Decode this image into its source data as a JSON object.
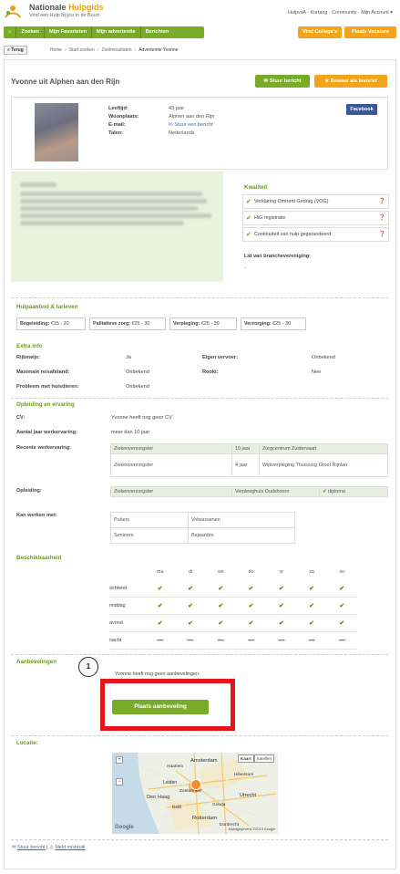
{
  "header": {
    "brand_a": "Nationale ",
    "brand_b": "Hulpgids",
    "slogan": "Vind een Hulp bij jou in de Buurt",
    "top_links": "HulpvsA · Kortang · Community · Mijn Account ▾"
  },
  "nav": {
    "items": [
      "Zoeken",
      "Mijn Favorieten",
      "Mijn advertentie",
      "Berichten"
    ],
    "right": [
      "Vind Collega's",
      "Plaats Vacature"
    ]
  },
  "breadcrumb": {
    "back": "« Terug",
    "items": [
      "Home",
      "Start zoeken",
      "Zoekresultaten",
      "Advertentie Yvonne"
    ]
  },
  "profile": {
    "title": "Yvonne uit Alphen aan den Rijn",
    "send_btn": "Stuur bericht",
    "fav_btn": "Bewaar als favoriet",
    "facebook": "Facebook",
    "fields": [
      {
        "label": "Leeftijd:",
        "value": "43 jaar"
      },
      {
        "label": "Woonplaats:",
        "value": "Alphen aan den Rijn"
      },
      {
        "label": "E-mail:",
        "value": "Stuur een bericht"
      },
      {
        "label": "Talen:",
        "value": "Nederlands"
      }
    ]
  },
  "kwaliteit": {
    "title": "Kwaliteit",
    "items": [
      "Verklaring Omtrent Gedrag (VOG)",
      "HiG registratie",
      "Continuïteit van hulp gegarandeerd"
    ],
    "lid_label": "Lid van branchevereniging:",
    "lid_value": "-"
  },
  "tarieven": {
    "title": "Hulpaanbod & tarieven",
    "items": [
      {
        "label": "Begeleiding:",
        "value": "€15 - 20"
      },
      {
        "label": "Palliatieve zorg:",
        "value": "€25 - 30"
      },
      {
        "label": "Verpleging:",
        "value": "€25 - 30"
      },
      {
        "label": "Verzorging:",
        "value": "€25 - 30"
      }
    ]
  },
  "extra": {
    "title": "Extra info",
    "rows": [
      {
        "l1": "Rijbewijs:",
        "v1": "Ja",
        "l2": "Eigen vervoer:",
        "v2": "Onbekend"
      },
      {
        "l1": "Maximale reisafstand:",
        "v1": "Onbekend",
        "l2": "Rookt:",
        "v2": "Nee"
      },
      {
        "l1": "Probleem met huisdieren:",
        "v1": "Onbekend",
        "l2": "",
        "v2": ""
      }
    ]
  },
  "opleiding": {
    "title": "Opleiding en ervaring",
    "cv_label": "CV:",
    "cv_value": "Yvonne heeft nog geen CV",
    "jaren_label": "Aantal jaar werkervaring:",
    "jaren_value": "meer dan 10 jaar",
    "recent_label": "Recente werkervaring:",
    "recent": [
      [
        "Ziekenverzorgster",
        "10 jaar",
        "Zorgcentrum Zuidervaart"
      ],
      [
        "Ziekenverzorgster",
        "4 jaar",
        "Wijkverpleging Thuiszorg Groot Rijnlan"
      ]
    ],
    "opl_label": "Opleiding:",
    "opl": [
      "Ziekenverzorgster",
      "Verpleeghuis Oudshoorn",
      "diploma"
    ],
    "kan_label": "Kan werken met:",
    "kan": [
      [
        "Pubers",
        "Volwassenen"
      ],
      [
        "Senioren",
        "Bejaarden"
      ]
    ]
  },
  "beschikbaarheid": {
    "title": "Beschikbaarheid",
    "days": [
      "ma",
      "di",
      "wo",
      "do",
      "vr",
      "za",
      "zo"
    ],
    "parts": [
      "ochtend",
      "middag",
      "avond",
      "nacht"
    ],
    "check": "✔",
    "dash": "—"
  },
  "aanbevelingen": {
    "title": "Aanbevelingen",
    "marker": "1",
    "text": "Yvonne heeft nog geen aanbevelingen.",
    "button": "Plaats aanbeveling"
  },
  "locatie": {
    "title": "Locatie:",
    "map_btns": [
      "Kaart",
      "Satelliet"
    ],
    "cities": [
      "Amsterdam",
      "Leiden",
      "Den Haag",
      "Rotterdam",
      "Utrecht",
      "Haarlem",
      "Delft",
      "Gouda",
      "Zoetermeer",
      "Dordrecht",
      "Hilversum"
    ],
    "google": "Google",
    "mapdata": "Kaartgegevens ©2013 Google"
  },
  "footer": {
    "send": "Stuur bericht",
    "sep": "|",
    "report": "Meld misbruik"
  }
}
